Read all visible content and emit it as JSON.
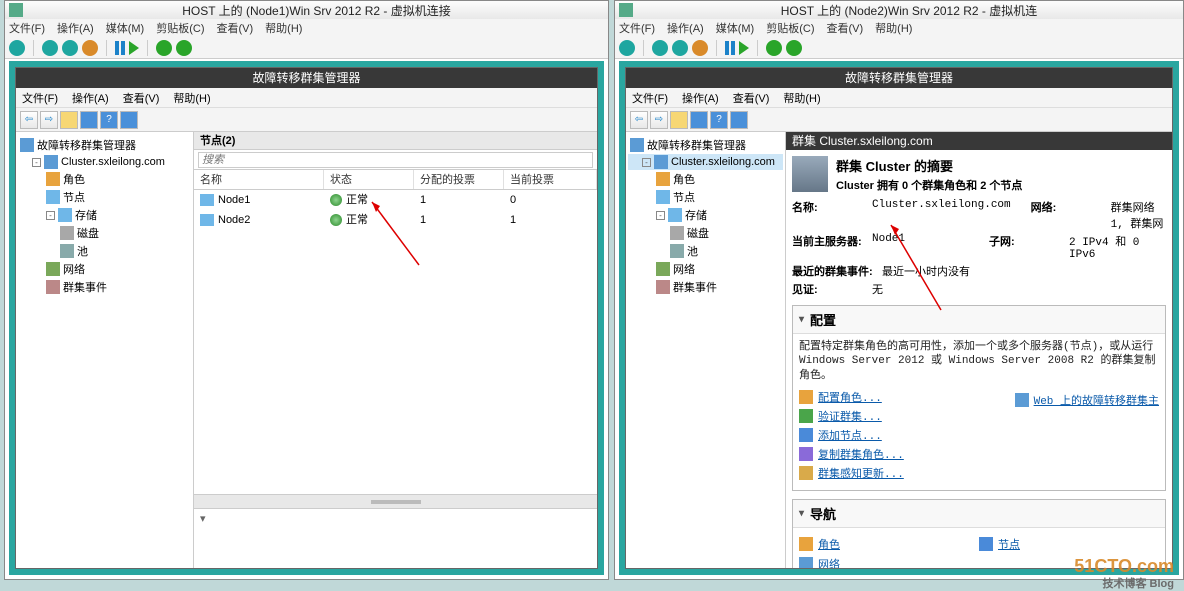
{
  "vm_left": {
    "title": "HOST 上的 (Node1)Win Srv 2012 R2 - 虚拟机连接",
    "menu": [
      "文件(F)",
      "操作(A)",
      "媒体(M)",
      "剪贴板(C)",
      "查看(V)",
      "帮助(H)"
    ]
  },
  "vm_right": {
    "title": "HOST 上的 (Node2)Win Srv 2012 R2 - 虚拟机连",
    "menu": [
      "文件(F)",
      "操作(A)",
      "媒体(M)",
      "剪贴板(C)",
      "查看(V)",
      "帮助(H)"
    ]
  },
  "mgr": {
    "title": "故障转移群集管理器",
    "menu": [
      "文件(F)",
      "操作(A)",
      "查看(V)",
      "帮助(H)"
    ]
  },
  "tree_left": {
    "root": "故障转移群集管理器",
    "cluster": "Cluster.sxleilong.com",
    "items": [
      "角色",
      "节点",
      "存储",
      "磁盘",
      "池",
      "网络",
      "群集事件"
    ]
  },
  "tree_right": {
    "root": "故障转移群集管理器",
    "cluster": "Cluster.sxleilong.com",
    "items": [
      "角色",
      "节点",
      "存储",
      "磁盘",
      "池",
      "网络",
      "群集事件"
    ]
  },
  "nodes_panel": {
    "header": "节点(2)",
    "search_ph": "搜索",
    "cols": {
      "name": "名称",
      "status": "状态",
      "vote": "分配的投票",
      "cur": "当前投票"
    },
    "rows": [
      {
        "name": "Node1",
        "status": "正常",
        "vote": "1",
        "cur": "0"
      },
      {
        "name": "Node2",
        "status": "正常",
        "vote": "1",
        "cur": "1"
      }
    ],
    "expander": "▾"
  },
  "summary": {
    "header": "群集 Cluster.sxleilong.com",
    "title": "群集 Cluster 的摘要",
    "subtitle": "Cluster 拥有 0 个群集角色和 2 个节点",
    "info": {
      "name_lbl": "名称:",
      "name_val": "Cluster.sxleilong.com",
      "host_lbl": "当前主服务器:",
      "host_val": "Node1",
      "event_lbl": "最近的群集事件:",
      "event_val": "最近一小时内没有",
      "witness_lbl": "见证:",
      "witness_val": "无",
      "net_lbl": "网络:",
      "net_val": "群集网络 1, 群集网",
      "subnet_lbl": "子网:",
      "subnet_val": "2 IPv4 和 0 IPv6"
    },
    "config": {
      "title": "配置",
      "desc": "配置特定群集角色的高可用性，添加一个或多个服务器(节点)，或从运行 Windows Server 2012 或 Windows Server 2008 R2 的群集复制角色。",
      "links": [
        "配置角色...",
        "验证群集...",
        "添加节点...",
        "复制群集角色...",
        "群集感知更新..."
      ],
      "web_link": "Web 上的故障转移群集主"
    },
    "nav": {
      "title": "导航",
      "items": [
        "角色",
        "节点",
        "网络"
      ]
    }
  },
  "watermark": "51CTO.com",
  "watermark_sub": "技术博客  Blog"
}
